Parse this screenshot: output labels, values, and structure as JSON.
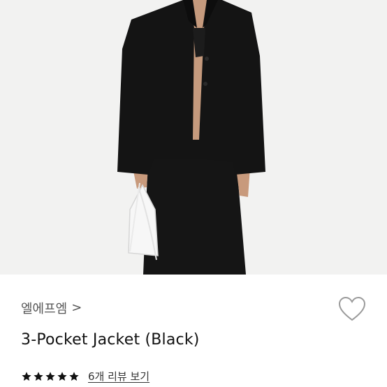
{
  "product": {
    "brand": "엘에프엠",
    "brand_chevron": ">",
    "title": "3-Pocket Jacket (Black)",
    "rating": 5,
    "max_rating": 5,
    "reviews_link": "6개 리뷰 보기"
  },
  "icons": {
    "wishlist": "heart-outline-icon",
    "star": "star-icon"
  },
  "colors": {
    "star": "#111111",
    "heart_stroke": "#9a9a9a"
  }
}
